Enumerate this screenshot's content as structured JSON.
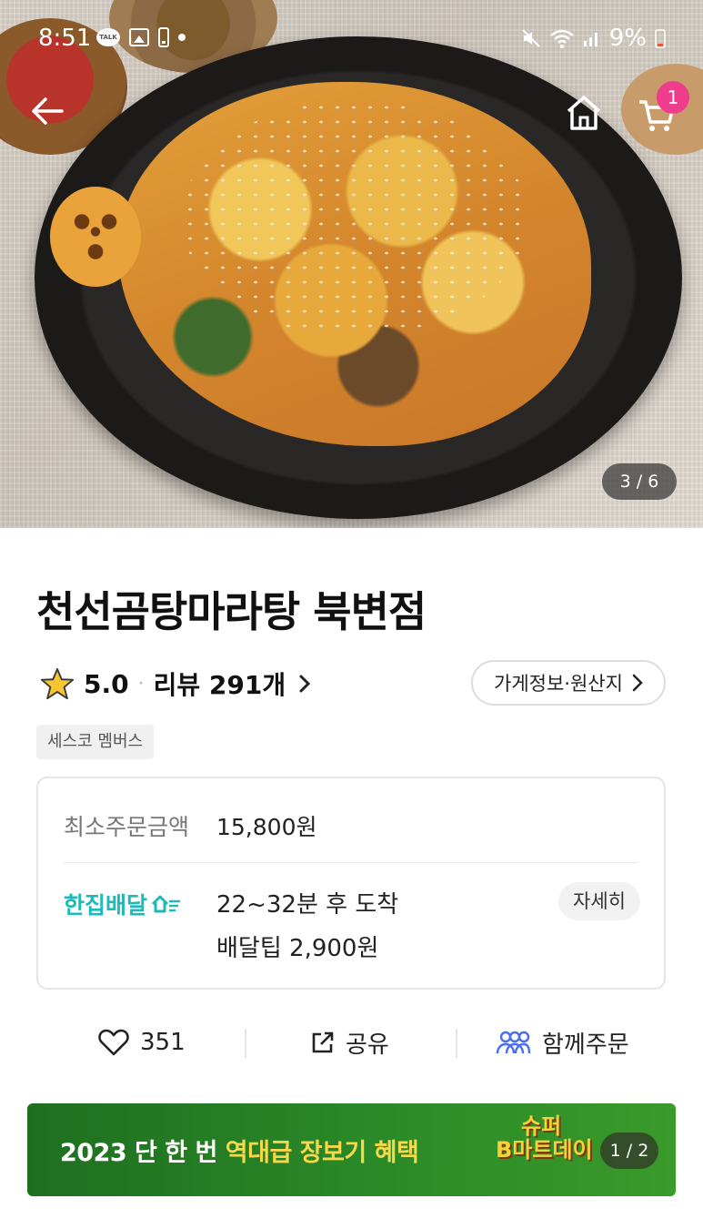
{
  "status_bar": {
    "time": "8:51",
    "talk_icon_label": "TALK",
    "battery": "9%"
  },
  "hero": {
    "image_counter": "3 / 6",
    "cart_badge": "1"
  },
  "store": {
    "name": "천선곰탕마라탕 북변점",
    "rating": "5.0",
    "review_label": "리뷰 291개",
    "info_button": "가게정보·원산지",
    "member_tag": "세스코 멤버스"
  },
  "order_card": {
    "min_order_label": "최소주문금액",
    "min_order_value": "15,800원",
    "delivery_brand": "한집배달",
    "eta": "22~32분 후 도착",
    "delivery_tip": "배달팁 2,900원",
    "detail_button": "자세히"
  },
  "actions": {
    "like_count": "351",
    "share_label": "공유",
    "group_order_label": "함께주문"
  },
  "banner": {
    "text_prefix": "2023 단 한 번 ",
    "text_highlight": "역대급 장보기 혜택",
    "logo_line1": "슈퍼",
    "logo_line2": "B마트데이",
    "counter": "1 / 2"
  },
  "colors": {
    "accent_mint": "#1fb9b9",
    "cart_badge": "#f03c8c",
    "group_icon": "#4a6cf0",
    "banner_green": "#2a8a28",
    "banner_highlight": "#f6d84a"
  }
}
